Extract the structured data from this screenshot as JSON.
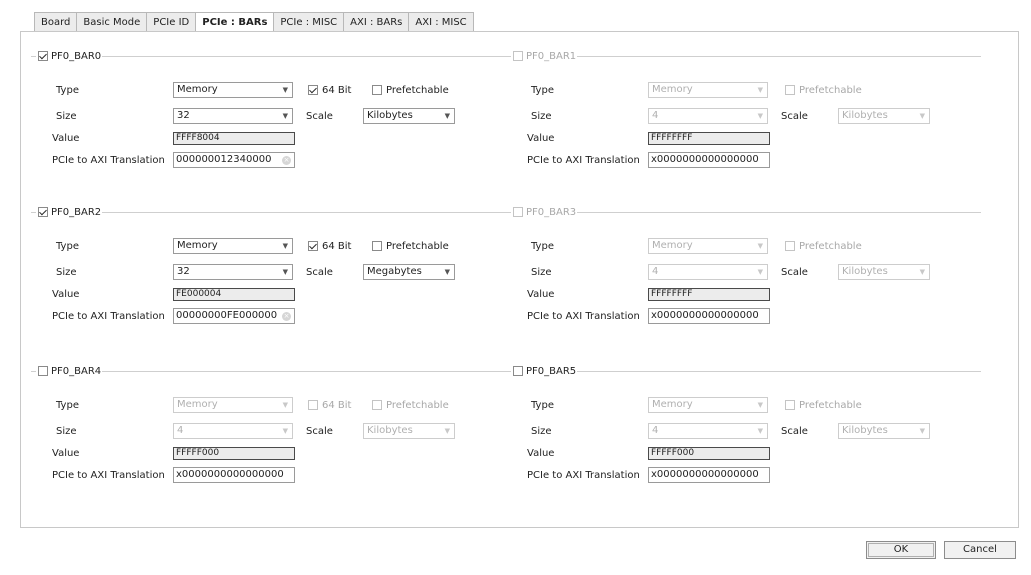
{
  "tabs": [
    "Board",
    "Basic Mode",
    "PCIe ID",
    "PCIe : BARs",
    "PCIe : MISC",
    "AXI : BARs",
    "AXI : MISC"
  ],
  "active_tab": "PCIe : BARs",
  "labels": {
    "type": "Type",
    "size": "Size",
    "scale": "Scale",
    "value": "Value",
    "translation": "PCIe to AXI Translation",
    "bit64": "64 Bit",
    "prefetchable": "Prefetchable"
  },
  "bars": [
    {
      "name": "PF0_BAR0",
      "enabled": true,
      "type": "Memory",
      "bit64": true,
      "prefetchable": false,
      "size": "32",
      "scale": "Kilobytes",
      "value": "FFFF8004",
      "translation": "000000012340000"
    },
    {
      "name": "PF0_BAR1",
      "enabled": false,
      "type": "Memory",
      "bit64": null,
      "prefetchable": false,
      "size": "4",
      "scale": "Kilobytes",
      "value": "FFFFFFFF",
      "translation": "x0000000000000000"
    },
    {
      "name": "PF0_BAR2",
      "enabled": true,
      "type": "Memory",
      "bit64": true,
      "prefetchable": false,
      "size": "32",
      "scale": "Megabytes",
      "value": "FE000004",
      "translation": "00000000FE000000"
    },
    {
      "name": "PF0_BAR3",
      "enabled": false,
      "type": "Memory",
      "bit64": null,
      "prefetchable": false,
      "size": "4",
      "scale": "Kilobytes",
      "value": "FFFFFFFF",
      "translation": "x0000000000000000"
    },
    {
      "name": "PF0_BAR4",
      "enabled": false,
      "type": "Memory",
      "bit64": false,
      "prefetchable": false,
      "size": "4",
      "scale": "Kilobytes",
      "value": "FFFFF000",
      "translation": "x0000000000000000"
    },
    {
      "name": "PF0_BAR5",
      "enabled": false,
      "type": "Memory",
      "bit64": null,
      "prefetchable": false,
      "size": "4",
      "scale": "Kilobytes",
      "value": "FFFFF000",
      "translation": "x0000000000000000"
    }
  ],
  "buttons": {
    "ok": "OK",
    "cancel": "Cancel"
  }
}
